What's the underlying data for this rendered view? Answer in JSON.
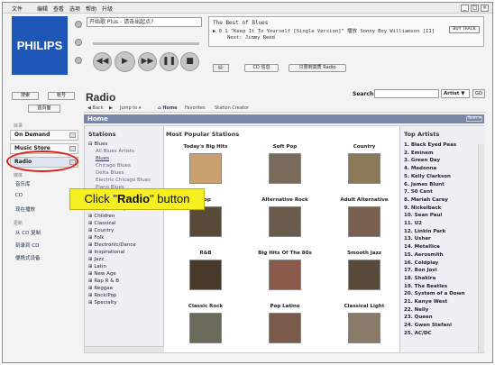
{
  "menu": [
    "文件",
    "编辑",
    "查看",
    "选项",
    "帮助",
    "升级"
  ],
  "window_controls": [
    "_",
    "□",
    "×"
  ],
  "logo": "PHILIPS",
  "player": {
    "search_text": "开始歌 Plus - 请击出起点?",
    "now_playing_title": "The Best of Blues",
    "now_playing_track": "▶ 0  1  \"Keep It To Yourself [Single Version]\" 播放 Sonny Boy Williamson [II]",
    "next_label": "Next: Jimmy Reed",
    "buy_label": "BUY TRACK",
    "small_button": "▤·",
    "btn_info": "CD 信息",
    "btn_hq": "只限到高质 Radio",
    "transport": [
      "◀◀",
      "▶",
      "▶▶",
      "❚❚",
      "■"
    ]
  },
  "sidebar": {
    "top_buttons": [
      "搜索",
      "帐号"
    ],
    "home_button": "首页面",
    "section1": "目录",
    "items": [
      "On Demand",
      "Music Store",
      "Radio"
    ],
    "section2": "媒体",
    "links2": [
      "音乐库",
      "CD",
      "现在播放"
    ],
    "section3": "更新",
    "links3": [
      "从 CD 复制",
      "刻录到 CD",
      "便携式设备"
    ]
  },
  "callout": {
    "pre": "Click \"",
    "bold": "Radio",
    "post": "\" button"
  },
  "main": {
    "title": "Radio",
    "search_label": "Search:",
    "search_scope": "Artist ▼",
    "go": "GO",
    "nav": [
      "◀ Back",
      "▶",
      "Jump to ▾",
      "⌂ Home",
      "Favorites",
      "Station Creator"
    ],
    "home_bar": "Home",
    "tools": "Tools ▾",
    "stations_header": "Stations",
    "stations": [
      {
        "t": "⊟ Blues",
        "c": ""
      },
      {
        "t": "All Blues Artists",
        "c": "sub"
      },
      {
        "t": "Blues",
        "c": "sub u"
      },
      {
        "t": "Chicago Blues",
        "c": "sub"
      },
      {
        "t": "Delta Blues",
        "c": "sub"
      },
      {
        "t": "Electric Chicago Blues",
        "c": "sub"
      },
      {
        "t": "Piano Blues",
        "c": "sub"
      },
      {
        "t": "Slide Guitar Blues",
        "c": "sub"
      },
      {
        "t": "West-Coast Blues",
        "c": "sub"
      },
      {
        "t": "All Blues Styles",
        "c": "sub"
      },
      {
        "t": "⊞ Children",
        "c": ""
      },
      {
        "t": "⊞ Classical",
        "c": ""
      },
      {
        "t": "⊞ Country",
        "c": ""
      },
      {
        "t": "⊞ Folk",
        "c": ""
      },
      {
        "t": "⊞ Electronic/Dance",
        "c": ""
      },
      {
        "t": "⊞ Inspirational",
        "c": ""
      },
      {
        "t": "⊞ Jazz",
        "c": ""
      },
      {
        "t": "⊞ Latin",
        "c": ""
      },
      {
        "t": "⊞ New Age",
        "c": ""
      },
      {
        "t": "⊞ Rap R & B",
        "c": ""
      },
      {
        "t": "⊞ Reggae",
        "c": ""
      },
      {
        "t": "⊞ Rock/Pop",
        "c": ""
      },
      {
        "t": "⊞ Specialty",
        "c": ""
      }
    ],
    "popular_header": "Most Popular Stations",
    "popular": [
      "Today's Big Hits",
      "Soft Pop",
      "Country",
      "Pop",
      "Alternative Rock",
      "Adult Alternative",
      "R&B",
      "Big Hits Of The 80s",
      "Smooth Jazz",
      "Classic Rock",
      "Pop Latino",
      "Classical Light"
    ],
    "top_artists_header": "Top Artists",
    "top_artists": [
      "1. Black Eyed Peas",
      "2. Eminem",
      "3. Green Day",
      "4. Madonna",
      "5. Kelly Clarkson",
      "6. James Blunt",
      "7. 50 Cent",
      "8. Mariah Carey",
      "9. Nickelback",
      "10. Sean Paul",
      "11. U2",
      "12. Linkin Park",
      "13. Usher",
      "14. Metallica",
      "15. Aerosmith",
      "16. Coldplay",
      "17. Bon Jovi",
      "18. Shakira",
      "19. The Beatles",
      "20. System of a Down",
      "21. Kanye West",
      "22. Nelly",
      "23. Queen",
      "24. Gwen Stefani",
      "25. AC/DC"
    ]
  }
}
